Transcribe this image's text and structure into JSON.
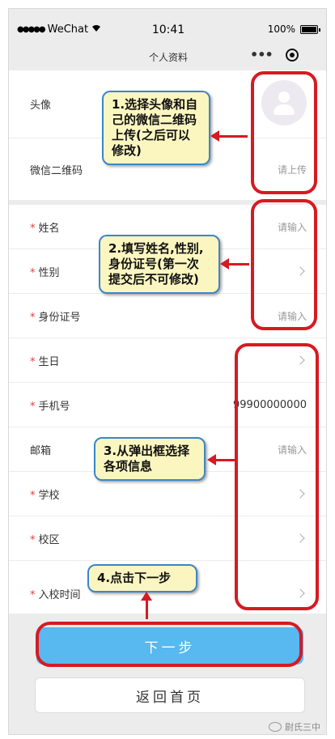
{
  "status_bar": {
    "signal": "●●●●●",
    "carrier": "WeChat",
    "time": "10:41",
    "battery": "100%"
  },
  "nav": {
    "title": "个人资料",
    "more": "•••"
  },
  "form": {
    "avatar_label": "头像",
    "qr_label": "微信二维码",
    "qr_value": "请上传",
    "required_mark": "*",
    "name_label": "姓名",
    "name_placeholder": "请输入",
    "gender_label": "性别",
    "id_label": "身份证号",
    "id_placeholder": "请输入",
    "birthday_label": "生日",
    "phone_label": "手机号",
    "phone_value": "99900000000",
    "email_label": "邮箱",
    "email_placeholder": "请输入",
    "school_label": "学校",
    "campus_label": "校区",
    "enroll_label": "入校时间"
  },
  "buttons": {
    "next": "下一步",
    "home": "返回首页"
  },
  "annotations": {
    "step1": "1.选择头像和自己的微信二维码上传(之后可以修改)",
    "step2": "2.填写姓名,性别,身份证号(第一次提交后不可修改)",
    "step3": "3.从弹出框选择各项信息",
    "step4": "4.点击下一步"
  },
  "watermark": "尉氏三中",
  "colors": {
    "accent_blue": "#58b8f0",
    "annotation_red": "#d61a22",
    "callout_bg": "#fbf6c0"
  }
}
